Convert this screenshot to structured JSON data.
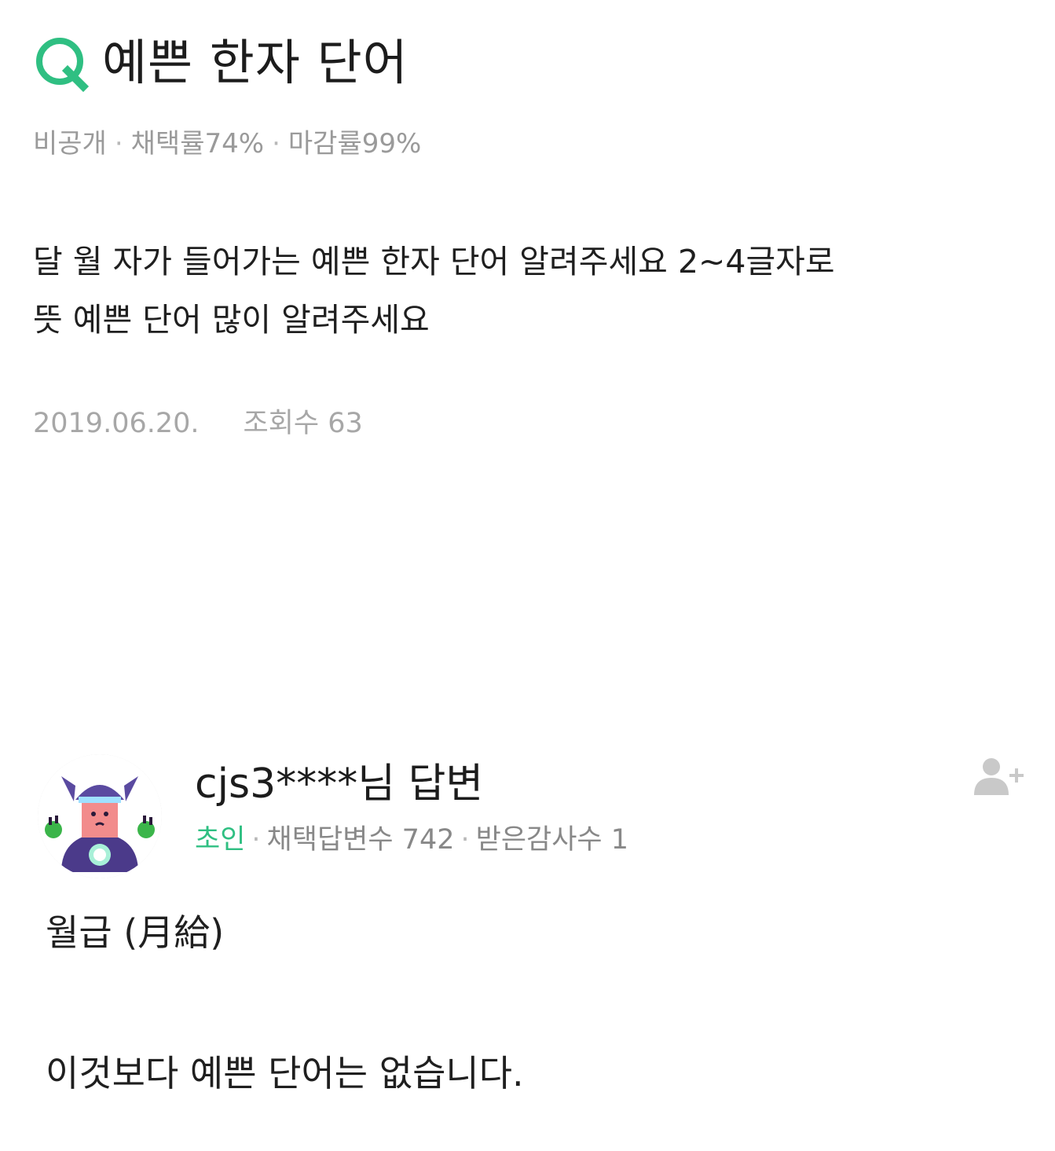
{
  "question": {
    "title": "예쁜 한자 단어",
    "meta": {
      "privacy": "비공개",
      "adoption_rate": "채택률74%",
      "closing_rate": "마감률99%"
    },
    "body_lines": [
      "달 월 자가 들어가는 예쁜 한자 단어 알려주세요 2~4글자로",
      "뜻 예쁜 단어 많이 알려주세요"
    ],
    "date": "2019.06.20.",
    "views": "조회수 63"
  },
  "answer": {
    "author": "cjs3****님 답변",
    "grade": "초인",
    "adopted_answers": "채택답변수 742",
    "thanks_received": "받은감사수 1",
    "body_lines": [
      "월급 (月給)",
      "이것보다 예쁜 단어는 없습니다."
    ]
  },
  "icons": {
    "question": "q-icon",
    "avatar": "character-avatar",
    "add_friend": "add-friend-icon"
  },
  "colors": {
    "accent_green": "#2fbf82",
    "meta_gray": "#9a9a9a",
    "text": "#1f1f1f"
  }
}
